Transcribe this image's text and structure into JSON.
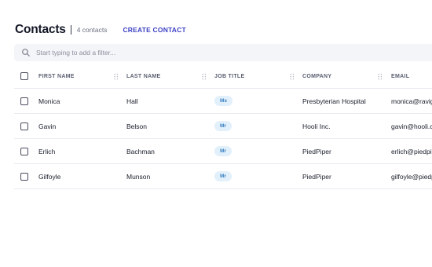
{
  "header": {
    "title": "Contacts",
    "count": "4 contacts",
    "create_label": "CREATE CONTACT"
  },
  "filter": {
    "placeholder": "Start typing to add a filter...",
    "icon": "search-icon"
  },
  "table": {
    "columns": [
      "FIRST NAME",
      "LAST NAME",
      "JOB TITLE",
      "COMPANY",
      "EMAIL"
    ],
    "rows": [
      {
        "first": "Monica",
        "last": "Hall",
        "title": "Ms",
        "company": "Presbyterian Hospital",
        "email": "monica@raviga"
      },
      {
        "first": "Gavin",
        "last": "Belson",
        "title": "Mr",
        "company": "Hooli Inc.",
        "email": "gavin@hooli.co"
      },
      {
        "first": "Erlich",
        "last": "Bachman",
        "title": "Mr",
        "company": "PiedPiper",
        "email": "erlich@piedpip"
      },
      {
        "first": "Gilfoyle",
        "last": "Munson",
        "title": "Mr",
        "company": "PiedPiper",
        "email": "gilfoyle@piedpi"
      }
    ]
  },
  "colors": {
    "accent": "#3b3fc4",
    "badge_bg": "#e2f0fb",
    "badge_text": "#3a7fc0",
    "filter_bg": "#f4f5f9"
  }
}
